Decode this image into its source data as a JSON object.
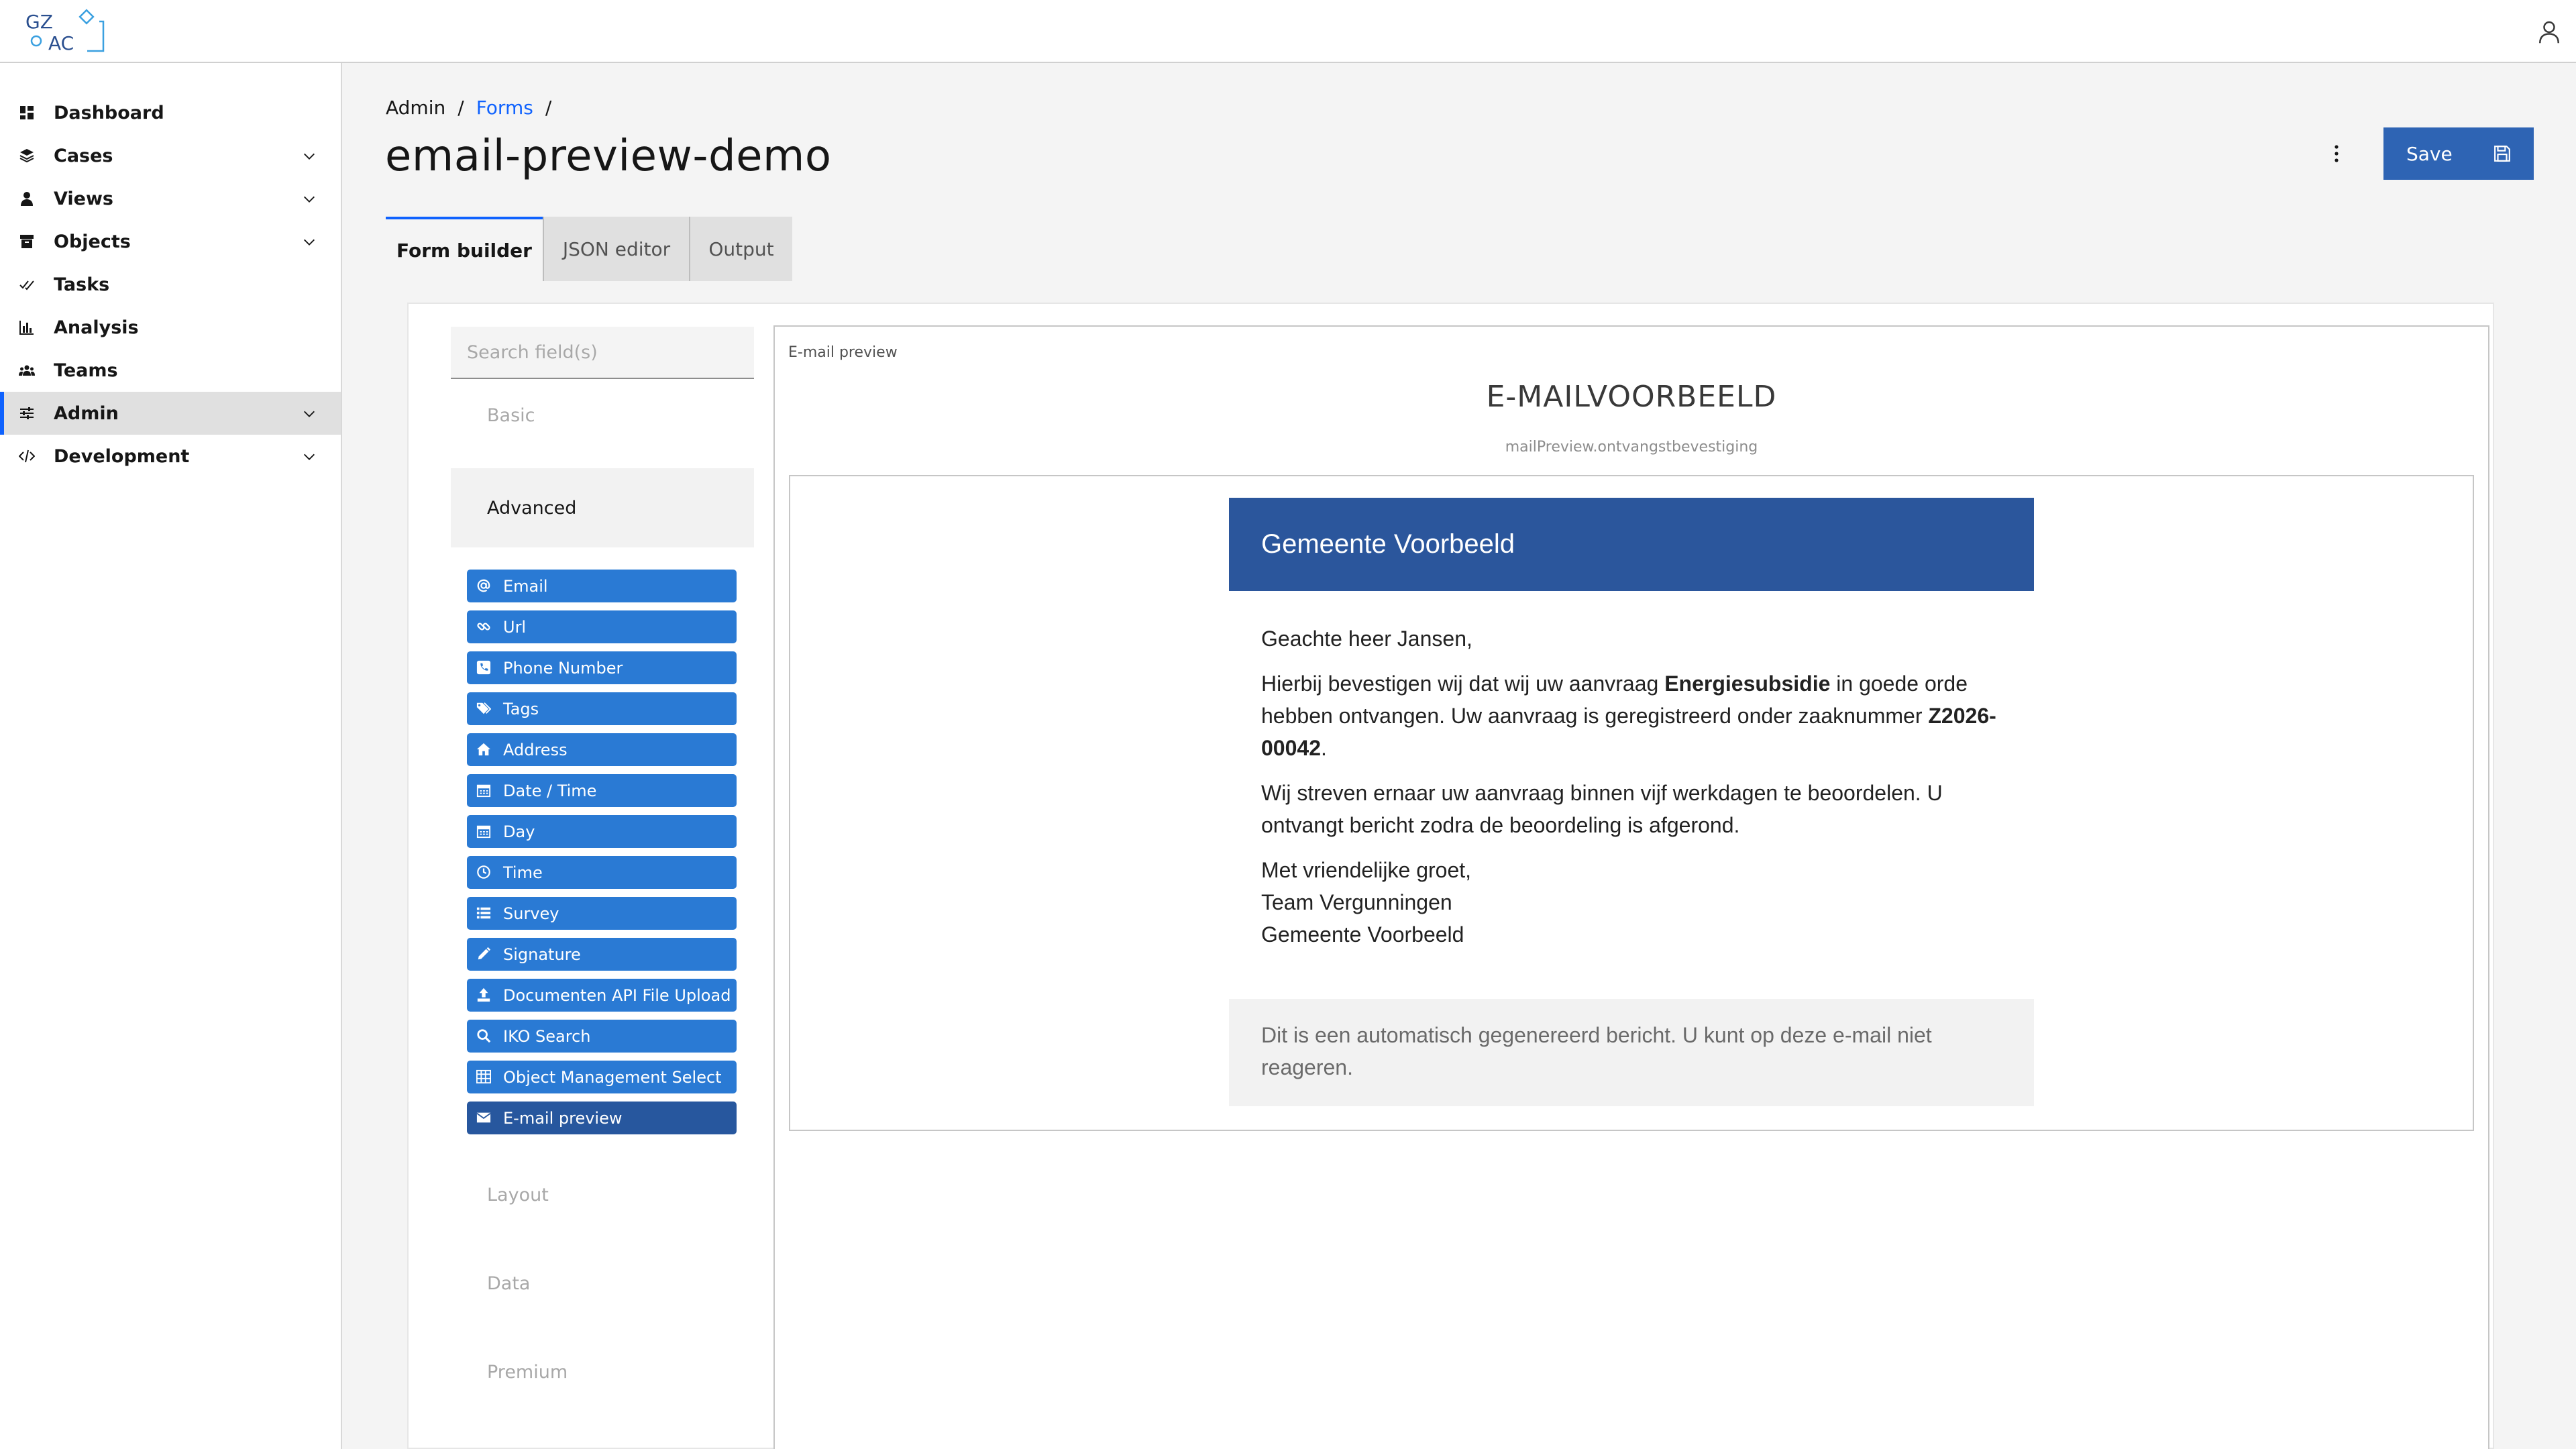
{
  "header": {
    "logo_text_top": "GZ",
    "logo_text_bottom": "AC",
    "user_icon": "user-icon"
  },
  "sidebar": {
    "items": [
      {
        "label": "Dashboard",
        "icon": "dashboard-icon",
        "expandable": false
      },
      {
        "label": "Cases",
        "icon": "layers-icon",
        "expandable": true
      },
      {
        "label": "Views",
        "icon": "person-icon",
        "expandable": true
      },
      {
        "label": "Objects",
        "icon": "archive-icon",
        "expandable": true
      },
      {
        "label": "Tasks",
        "icon": "task-check-icon",
        "expandable": false
      },
      {
        "label": "Analysis",
        "icon": "bar-chart-icon",
        "expandable": false
      },
      {
        "label": "Teams",
        "icon": "group-icon",
        "expandable": false
      },
      {
        "label": "Admin",
        "icon": "settings-adjust-icon",
        "expandable": true,
        "active": true
      },
      {
        "label": "Development",
        "icon": "code-icon",
        "expandable": true
      }
    ],
    "accent_color": "#0f62fe"
  },
  "breadcrumb": {
    "items": [
      "Admin",
      "Forms"
    ],
    "separator": "/"
  },
  "page": {
    "title": "email-preview-demo",
    "save_label": "Save"
  },
  "tabs": [
    {
      "label": "Form builder",
      "active": true
    },
    {
      "label": "JSON editor",
      "active": false
    },
    {
      "label": "Output",
      "active": false
    }
  ],
  "builder": {
    "search_placeholder": "Search field(s)",
    "groups": {
      "basic": "Basic",
      "advanced": "Advanced",
      "layout": "Layout",
      "data": "Data",
      "premium": "Premium"
    },
    "components": [
      {
        "label": "Email",
        "icon": "at-icon"
      },
      {
        "label": "Url",
        "icon": "link-icon"
      },
      {
        "label": "Phone Number",
        "icon": "phone-icon"
      },
      {
        "label": "Tags",
        "icon": "tags-icon"
      },
      {
        "label": "Address",
        "icon": "home-icon"
      },
      {
        "label": "Date / Time",
        "icon": "calendar-icon"
      },
      {
        "label": "Day",
        "icon": "calendar-icon"
      },
      {
        "label": "Time",
        "icon": "clock-icon"
      },
      {
        "label": "Survey",
        "icon": "list-icon"
      },
      {
        "label": "Signature",
        "icon": "pencil-icon"
      },
      {
        "label": "Documenten API File Upload",
        "icon": "upload-icon"
      },
      {
        "label": "IKO Search",
        "icon": "search-icon"
      },
      {
        "label": "Object Management Select",
        "icon": "table-icon"
      },
      {
        "label": "E-mail preview",
        "icon": "envelope-icon",
        "selected": true
      }
    ],
    "button_color": "#2a7ad4"
  },
  "preview": {
    "label": "E-mail preview",
    "heading": "E-MAILVOORBEELD",
    "key": "mailPreview.ontvangstbevestiging",
    "email": {
      "banner": "Gemeente Voorbeeld",
      "banner_color": "#2b569c",
      "greeting": "Geachte heer Jansen,",
      "p1_a": "Hierbij bevestigen wij dat wij uw aanvraag ",
      "p1_b": "Energiesubsidie",
      "p1_c": " in goede orde hebben ontvangen. Uw aanvraag is geregistreerd onder zaaknummer ",
      "p1_d": "Z2026-00042",
      "p1_e": ".",
      "p2": "Wij streven ernaar uw aanvraag binnen vijf werkdagen te beoordelen. U ontvangt bericht zodra de beoordeling is afgerond.",
      "closing_1": "Met vriendelijke groet,",
      "closing_2": "Team Vergunningen",
      "closing_3": "Gemeente Voorbeeld",
      "footer": "Dit is een automatisch gegenereerd bericht. U kunt op deze e-mail niet reageren."
    }
  }
}
